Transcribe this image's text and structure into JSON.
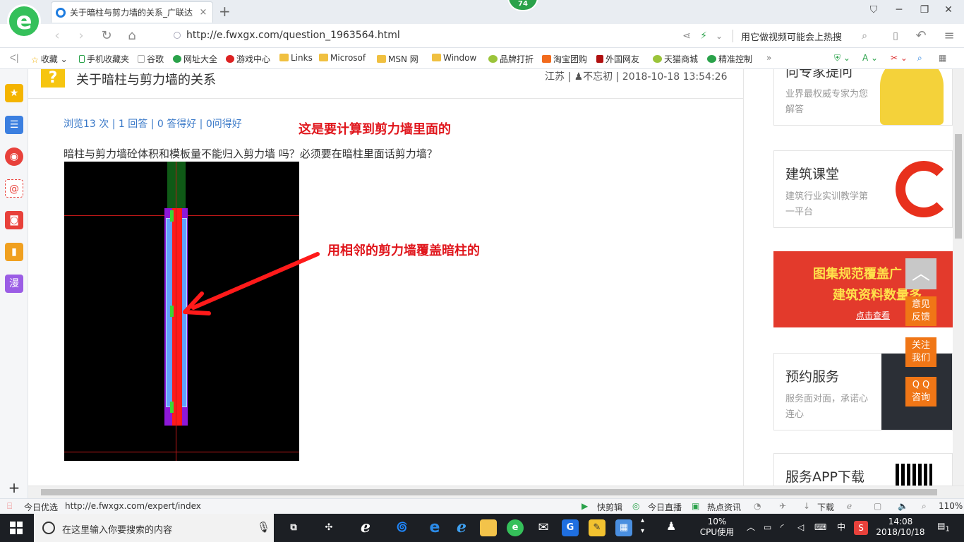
{
  "browser": {
    "tab_title": "关于暗柱与剪力墙的关系_广联达",
    "tab_close": "×",
    "new_tab": "+",
    "badge_count": "74",
    "url": "http://e.fwxgx.com/question_1963564.html",
    "search_hint": "用它做视频可能会上热搜",
    "logo_letter": "e"
  },
  "bookmarks": [
    {
      "label": "收藏",
      "icon": "star-icon"
    },
    {
      "label": "手机收藏夹",
      "icon": "phone-icon"
    },
    {
      "label": "谷歌",
      "icon": "page-icon"
    },
    {
      "label": "网址大全",
      "icon": "compass-icon"
    },
    {
      "label": "游戏中心",
      "icon": "game-icon"
    },
    {
      "label": "Links",
      "icon": "folder-icon"
    },
    {
      "label": "Microsof",
      "icon": "folder-icon"
    },
    {
      "label": "MSN 网",
      "icon": "folder-icon"
    },
    {
      "label": "Window",
      "icon": "folder-icon"
    },
    {
      "label": "品牌打折",
      "icon": "leaf-icon"
    },
    {
      "label": "淘宝团购",
      "icon": "taobao-icon"
    },
    {
      "label": "外国网友",
      "icon": "flag-icon"
    },
    {
      "label": "天猫商城",
      "icon": "leaf-icon"
    },
    {
      "label": "精准控制",
      "icon": "chat-icon"
    }
  ],
  "sidebar": {
    "manga_label": "漫"
  },
  "question": {
    "icon_char": "?",
    "title": "关于暗柱与剪力墙的关系",
    "meta": "江苏 | ♟不忘初 | 2018-10-18 13:54:26",
    "stats": "浏览13 次 | 1 回答 | 0 答得好 | 0问得好",
    "body": "暗柱与剪力墙砼体积和模板量不能归入剪力墙 吗？必须要在暗柱里面话剪力墙？",
    "annotation_1": "这是要计算到剪力墙里面的",
    "annotation_2": "用相邻的剪力墙覆盖暗柱的"
  },
  "right_cards": [
    {
      "title": "向专家提问",
      "subtitle": "业界最权威专家为您解答"
    },
    {
      "title": "建筑课堂",
      "subtitle": "建筑行业实训教学第一平台"
    },
    {
      "title": "预约服务",
      "subtitle": "服务面对面，承诺心连心"
    },
    {
      "title": "服务APP下载",
      "subtitle": ""
    }
  ],
  "banner": {
    "line1": "图集规范覆盖广",
    "line2": "建筑资料数量多",
    "link": "点击查看"
  },
  "float_buttons": {
    "scroll_top": "︿",
    "feedback": "意见\n反馈",
    "follow": "关注\n我们",
    "qq": "Q Q\n咨询"
  },
  "statusbar": {
    "today": "今日优选",
    "hover_url": "http://e.fwxgx.com/expert/index",
    "kuaijianji": "快剪辑",
    "live": "今日直播",
    "news": "热点资讯",
    "download": "下载",
    "zoom": "110%"
  },
  "taskbar": {
    "search_placeholder": "在这里输入你要搜索的内容",
    "cpu_percent": "10%",
    "cpu_label": "CPU使用",
    "ime": "中",
    "time": "14:08",
    "date": "2018/10/18",
    "notif_count": "1"
  },
  "colors": {
    "annotation_red": "#e0161c",
    "link_blue": "#3a79c8",
    "float_orange": "#f07616",
    "browser_green": "#35c05a"
  }
}
